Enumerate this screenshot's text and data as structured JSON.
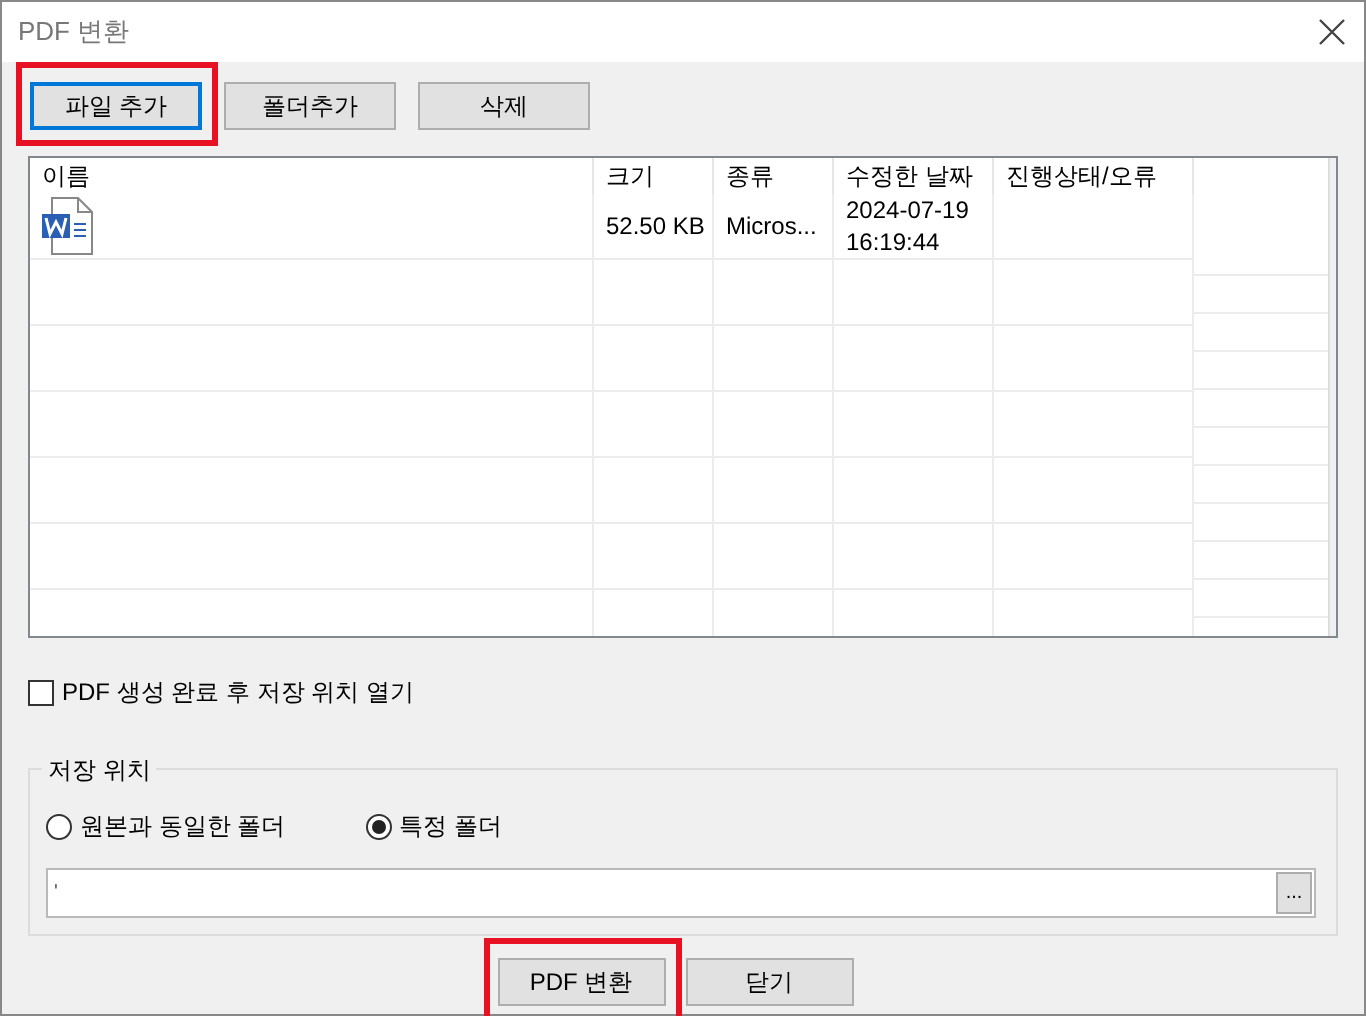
{
  "window": {
    "title": "PDF 변환"
  },
  "toolbar": [
    {
      "label": "파일 추가",
      "focused": true,
      "highlighted": true
    },
    {
      "label": "폴더추가",
      "focused": false,
      "highlighted": false
    },
    {
      "label": "삭제",
      "focused": false,
      "highlighted": false
    }
  ],
  "file_list": {
    "columns": [
      "이름",
      "크기",
      "종류",
      "수정한 날짜",
      "진행상태/오류"
    ],
    "rows": [
      {
        "kind": "word",
        "size": "52.50 KB",
        "type": "Micros...",
        "modified": [
          "2024-07-19",
          "16:19:44"
        ]
      }
    ]
  },
  "open_after": {
    "label": "PDF 생성 완료 후 저장 위치 열기",
    "checked": false
  },
  "save_location": {
    "title": "저장 위치",
    "options": [
      {
        "label": "원본과 동일한 폴더",
        "selected": false
      },
      {
        "label": "특정 폴더",
        "selected": true
      }
    ],
    "path": "'",
    "browse": "..."
  },
  "buttons": [
    {
      "label": "PDF 변환",
      "highlighted": true
    },
    {
      "label": "닫기",
      "highlighted": false
    }
  ]
}
